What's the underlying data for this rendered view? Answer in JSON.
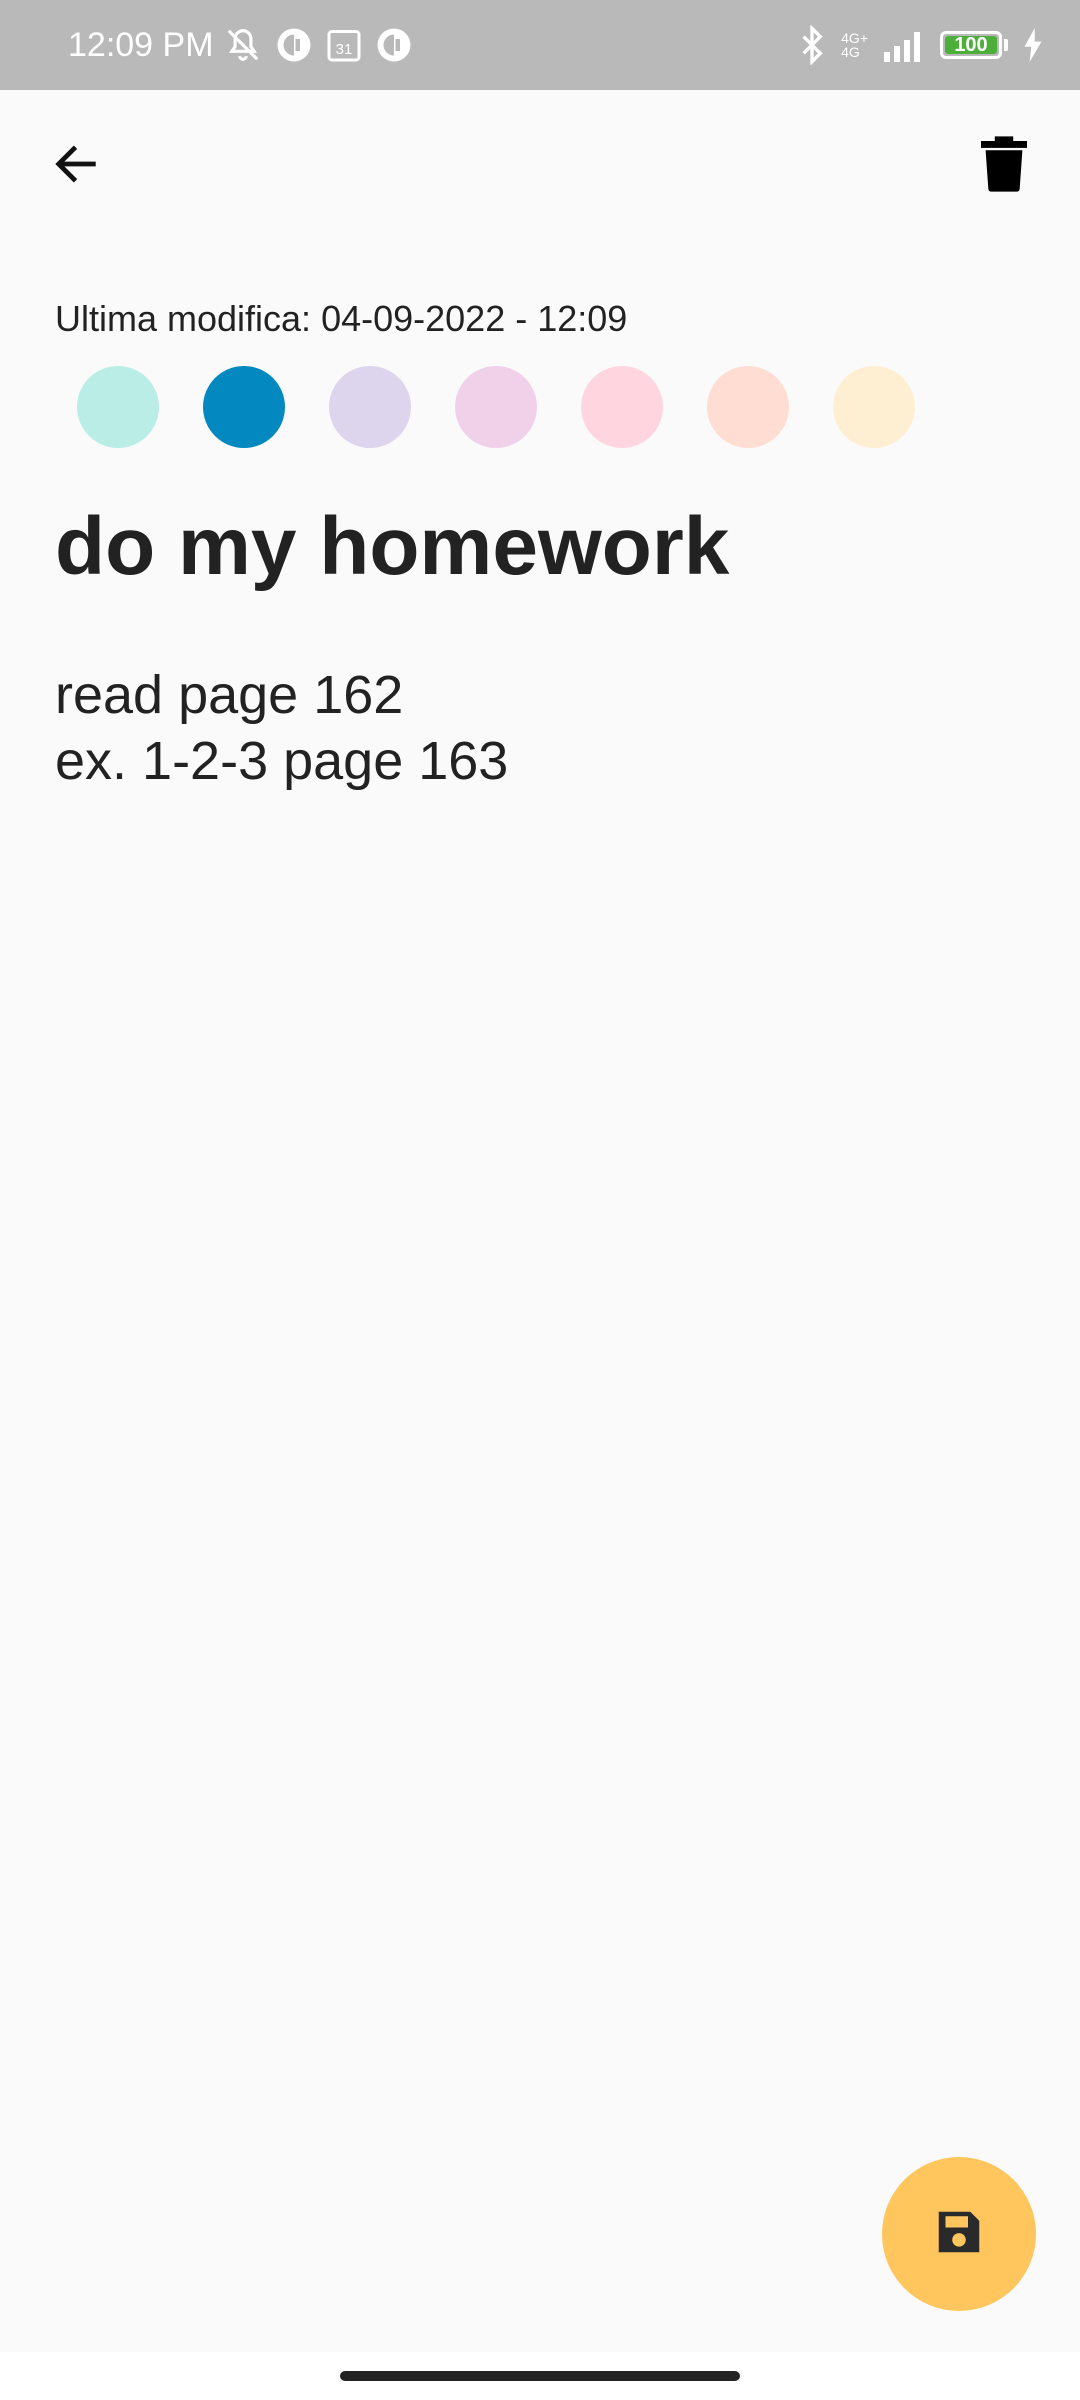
{
  "status_bar": {
    "time": "12:09 PM",
    "network": "4G+",
    "network_secondary": "4G",
    "battery_level": "100",
    "left_icons": [
      "bell-off-icon",
      "app-icon",
      "calendar-31-icon",
      "app-icon"
    ],
    "right_icons": [
      "bluetooth-icon",
      "signal-icon",
      "battery-icon",
      "charging-icon"
    ]
  },
  "toolbar": {
    "back_icon": "arrow-left-icon",
    "delete_icon": "trash-icon"
  },
  "note": {
    "last_modified": "Ultima modifica: 04-09-2022 - 12:09",
    "title": "do my homework",
    "body_lines": [
      "read page 162",
      "ex. 1-2-3 page 163"
    ]
  },
  "colors": {
    "swatches": [
      "#b9ede6",
      "#0388c0",
      "#ddd4ee",
      "#f1d1ea",
      "#ffd6e0",
      "#ffddd2",
      "#ffefd2"
    ],
    "selected_index": 1,
    "fab": "#ffc65e"
  },
  "fab": {
    "icon": "save-icon"
  }
}
